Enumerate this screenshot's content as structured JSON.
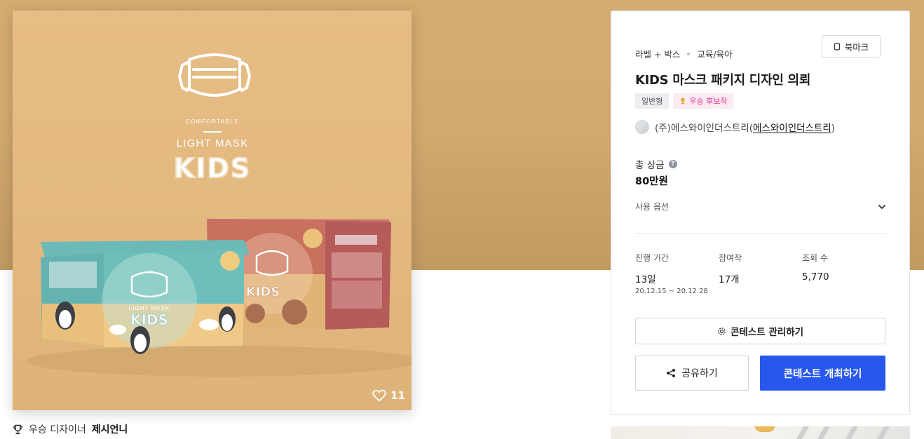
{
  "artwork": {
    "brand_small": "COMFORTABLE",
    "brand_line": "LIGHT MASK",
    "brand_big": "KIDS",
    "likes": "11"
  },
  "winner": {
    "prefix": "우승 디자이너",
    "name": "제시언니"
  },
  "contest": {
    "category": "라벨 + 박스",
    "subcategory": "교육/육아",
    "bookmark_label": "북마크",
    "title": "KIDS 마스크 패키지 디자인 의뢰",
    "tags": [
      "일반형",
      "우승 후보작"
    ],
    "host_name": "(주)에스와이인더스트리",
    "host_link": "에스와이인더스트리",
    "prize_label": "총 상금",
    "prize_value": "80만원",
    "usage_label": "사용 옵션",
    "stats": [
      {
        "label": "진행 기간",
        "value": "13일",
        "sub": "20.12.15 ~ 20.12.28"
      },
      {
        "label": "참여작",
        "value": "17개",
        "sub": ""
      },
      {
        "label": "조회 수",
        "value": "5,770",
        "sub": ""
      }
    ],
    "manage_label": "콘테스트 관리하기",
    "share_label": "공유하기",
    "host_button_label": "콘테스트 개최하기"
  },
  "colors": {
    "banner": "#d4ac72",
    "primary": "#2757ec",
    "candidate_tag": "#e0338a"
  }
}
